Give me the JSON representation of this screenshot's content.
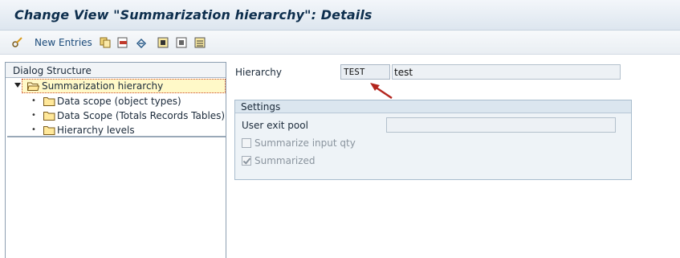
{
  "window": {
    "title": "Change View \"Summarization hierarchy\": Details"
  },
  "toolbar": {
    "new_entries_label": "New Entries",
    "icons": [
      "edit-glasses-icon",
      "copy-icon",
      "delete-icon",
      "undo-icon",
      "select-all-icon",
      "select-block-icon",
      "deselect-all-icon"
    ]
  },
  "dialog_structure": {
    "header": "Dialog Structure",
    "root": {
      "label": "Summarization hierarchy",
      "expanded": true,
      "selected": true
    },
    "children": [
      {
        "label": "Data scope (object types)"
      },
      {
        "label": "Data Scope (Totals Records Tables)"
      },
      {
        "label": "Hierarchy levels"
      }
    ]
  },
  "detail": {
    "hierarchy_label": "Hierarchy",
    "hierarchy_code": "TEST",
    "hierarchy_text": "test",
    "settings": {
      "title": "Settings",
      "user_exit_pool_label": "User exit pool",
      "user_exit_pool_value": "",
      "summarize_input_qty": {
        "label": "Summarize input qty",
        "checked": false
      },
      "summarized": {
        "label": "Summarized",
        "checked": true
      }
    }
  },
  "colors": {
    "title": "#0d2e4d",
    "tree_selected_bg": "#fff9c8",
    "annotation_arrow": "#b3261e",
    "link": "#1a4a7a"
  }
}
